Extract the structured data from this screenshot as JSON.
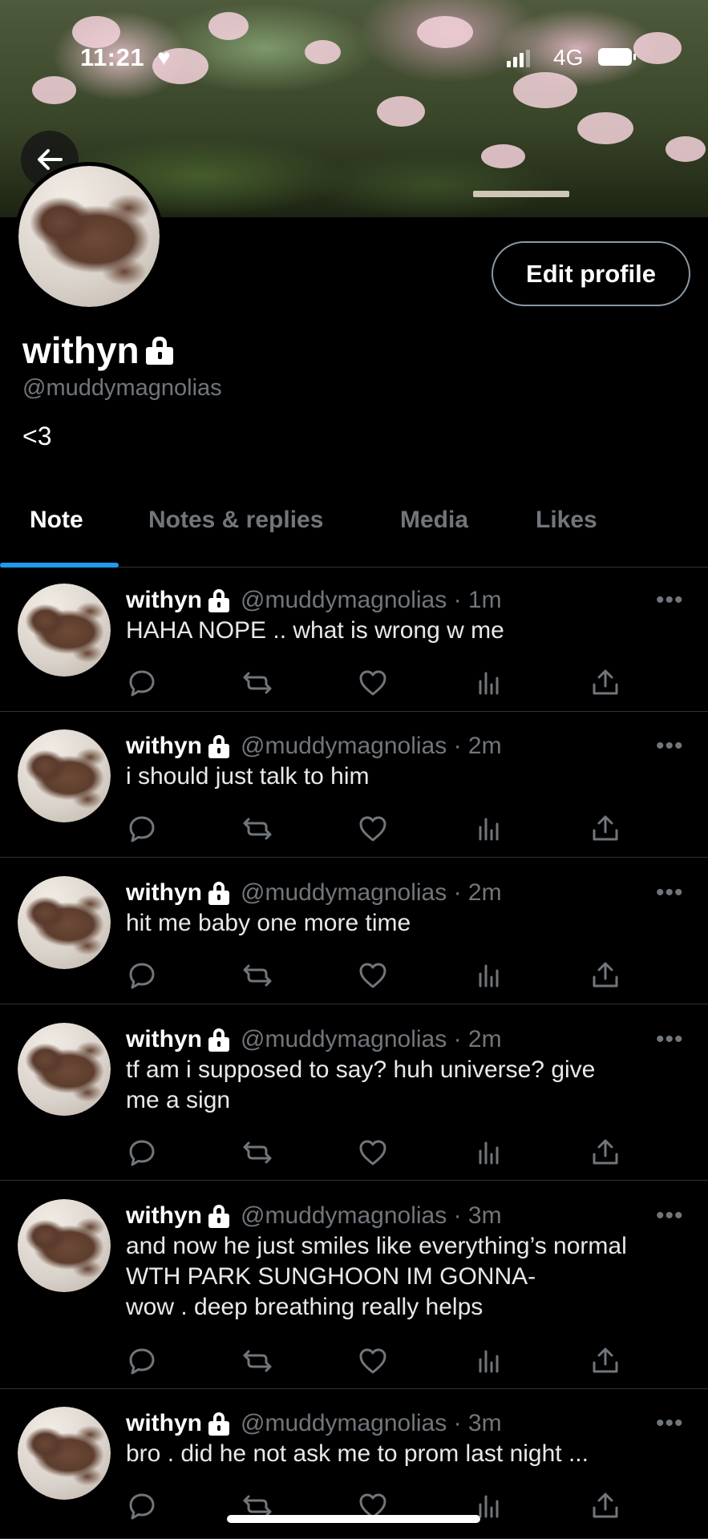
{
  "status_bar": {
    "time": "11:21",
    "network": "4G"
  },
  "profile": {
    "display_name": "withyn",
    "handle": "@muddymagnolias",
    "bio": "<3",
    "edit_button": "Edit profile"
  },
  "tabs": [
    {
      "label": "Note",
      "active": true
    },
    {
      "label": "Notes & replies",
      "active": false
    },
    {
      "label": "Media",
      "active": false
    },
    {
      "label": "Likes",
      "active": false
    }
  ],
  "posts": [
    {
      "name": "withyn",
      "meta": "@muddymagnolias · 1m",
      "text": "HAHA NOPE .. what is wrong w me"
    },
    {
      "name": "withyn",
      "meta": "@muddymagnolias · 2m",
      "text": "i should just talk to him"
    },
    {
      "name": "withyn",
      "meta": "@muddymagnolias · 2m",
      "text": "hit me baby one more time"
    },
    {
      "name": "withyn",
      "meta": "@muddymagnolias · 2m",
      "text": "tf am i supposed to say? huh universe? give\nme a sign"
    },
    {
      "name": "withyn",
      "meta": "@muddymagnolias · 3m",
      "text": "and now he just smiles like everything’s normal\nWTH PARK SUNGHOON IM GONNA-\nwow . deep breathing really helps"
    },
    {
      "name": "withyn",
      "meta": "@muddymagnolias · 3m",
      "text": "bro . did he not ask me to prom last night ..."
    }
  ],
  "post_more_label": "•••",
  "colors": {
    "accent": "#1d9bf0",
    "background": "#000000",
    "muted": "#71767b"
  }
}
